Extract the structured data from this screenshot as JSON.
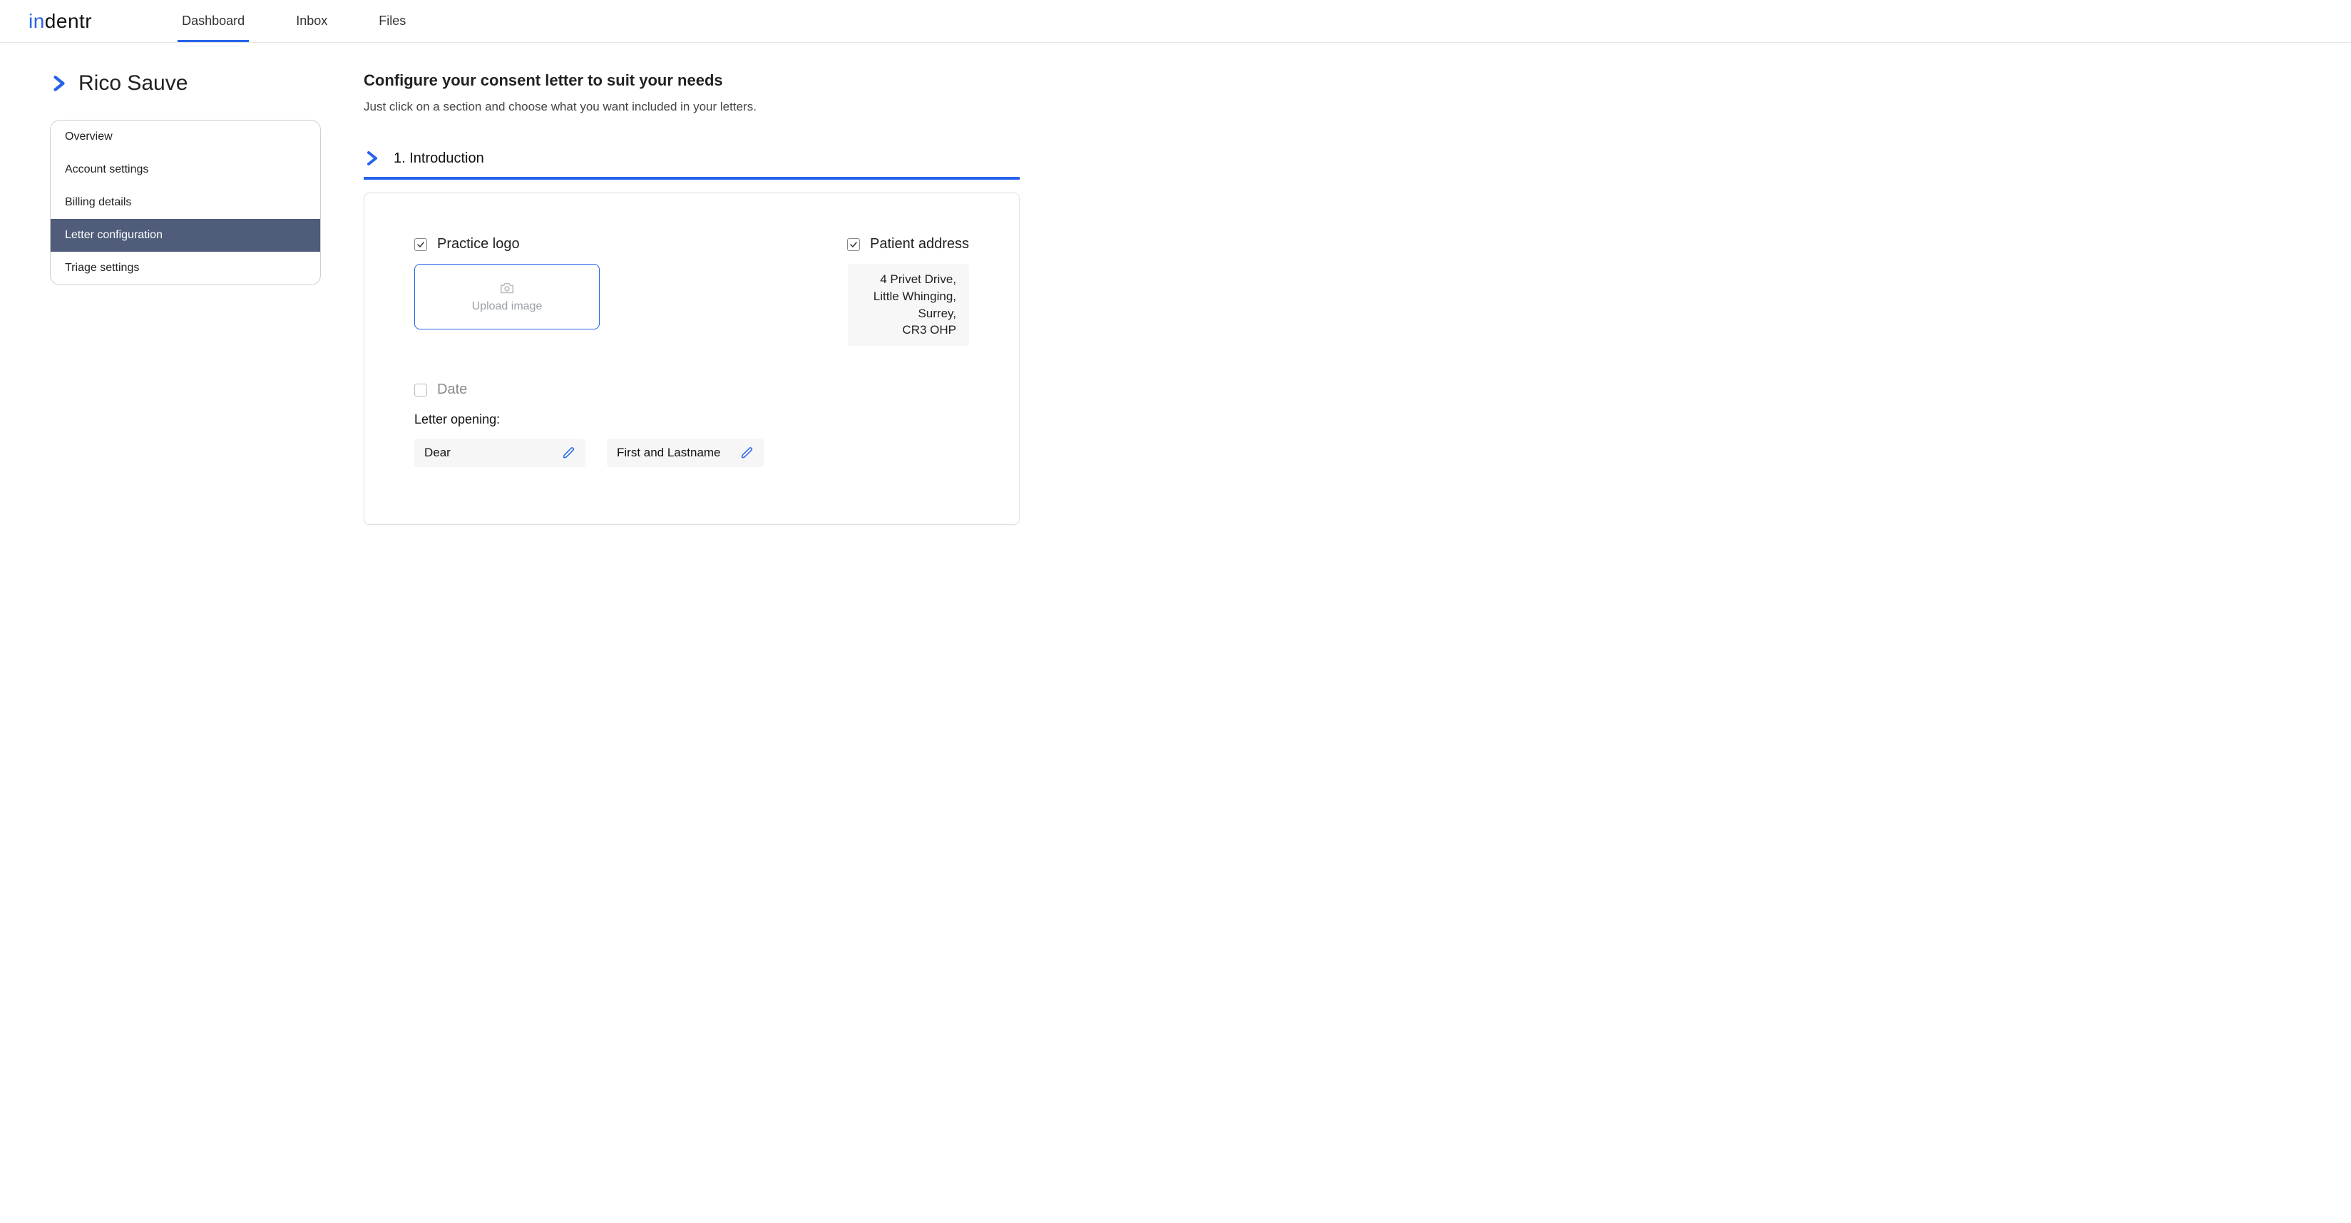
{
  "brand": {
    "prefix": "in",
    "suffix": "dentr"
  },
  "nav": {
    "tabs": [
      {
        "label": "Dashboard",
        "active": true
      },
      {
        "label": "Inbox",
        "active": false
      },
      {
        "label": "Files",
        "active": false
      }
    ]
  },
  "sidebar": {
    "user_name": "Rico Sauve",
    "items": [
      {
        "label": "Overview",
        "active": false
      },
      {
        "label": "Account settings",
        "active": false
      },
      {
        "label": "Billing details",
        "active": false
      },
      {
        "label": "Letter configuration",
        "active": true
      },
      {
        "label": "Triage settings",
        "active": false
      }
    ]
  },
  "main": {
    "title": "Configure your consent letter to suit your needs",
    "subtitle": "Just click on a section and choose what you want included in your letters.",
    "section_title": "1. Introduction",
    "practice_logo": {
      "label": "Practice logo",
      "checked": true,
      "upload_text": "Upload image"
    },
    "patient_address": {
      "label": "Patient address",
      "checked": true,
      "lines": [
        "4 Privet Drive,",
        "Little Whinging,",
        "Surrey,",
        "CR3 OHP"
      ]
    },
    "date": {
      "label": "Date",
      "checked": false
    },
    "opening": {
      "label": "Letter opening:",
      "salutation": "Dear",
      "name_format": "First and Lastname"
    }
  }
}
